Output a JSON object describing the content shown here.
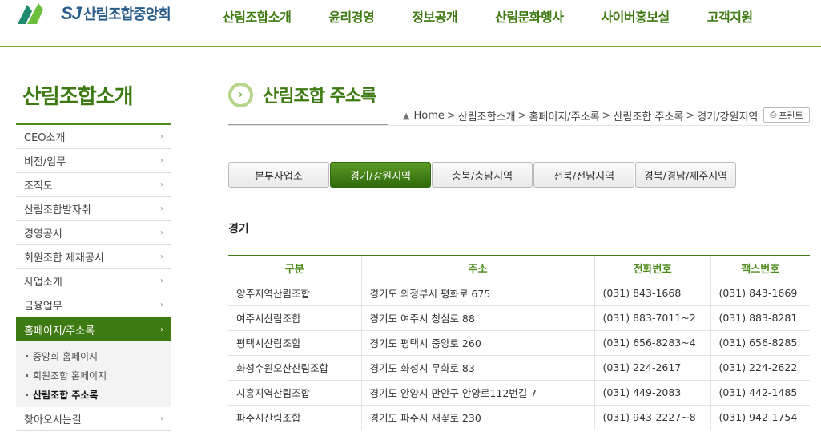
{
  "header": {
    "logo_sj": "SJ",
    "logo_text": "산림조합중앙회",
    "nav": [
      "산림조합소개",
      "윤리경영",
      "정보공개",
      "산림문화행사",
      "사이버홍보실",
      "고객지원"
    ]
  },
  "sidebar": {
    "title": "산림조합소개",
    "items": [
      {
        "label": "CEO소개"
      },
      {
        "label": "비전/임무"
      },
      {
        "label": "조직도"
      },
      {
        "label": "산림조합발자취"
      },
      {
        "label": "경영공시"
      },
      {
        "label": "회원조합 제재공시"
      },
      {
        "label": "사업소개"
      },
      {
        "label": "금융업무"
      },
      {
        "label": "홈페이지/주소록"
      }
    ],
    "sub_items": [
      {
        "label": "중앙회 홈페이지"
      },
      {
        "label": "회원조합 홈페이지"
      },
      {
        "label": "산림조합 주소록"
      }
    ],
    "last_item": {
      "label": "찾아오시는길"
    },
    "arrow": "›"
  },
  "main": {
    "title": "산림조합 주소록",
    "breadcrumb": [
      "Home",
      "산림조합소개",
      "홈페이지/주소록",
      "산림조합 주소록",
      "경기/강원지역"
    ],
    "breadcrumb_sep": ">",
    "print_label": "프린트",
    "tabs": [
      "본부사업소",
      "경기/강원지역",
      "충북/충남지역",
      "전북/전남지역",
      "경북/경남/제주지역"
    ],
    "section_title": "경기",
    "table": {
      "headers": [
        "구분",
        "주소",
        "전화번호",
        "팩스번호"
      ],
      "rows": [
        [
          "양주지역산림조합",
          "경기도 의정부시 평화로 675",
          "(031) 843-1668",
          "(031) 843-1669"
        ],
        [
          "여주시산림조합",
          "경기도 여주시 청심로 88",
          "(031) 883-7011~2",
          "(031) 883-8281"
        ],
        [
          "평택시산림조합",
          "경기도 평택시 중앙로 260",
          "(031) 656-8283~4",
          "(031) 656-8285"
        ],
        [
          "화성수원오산산림조합",
          "경기도 화성시 무화로 83",
          "(031) 224-2617",
          "(031) 224-2622"
        ],
        [
          "시흥지역산림조합",
          "경기도 안양시 만안구 안양로112번길 7",
          "(031) 449-2083",
          "(031) 442-1485"
        ],
        [
          "파주시산림조합",
          "경기도 파주시 새꽃로 230",
          "(031) 943-2227~8",
          "(031) 942-1754"
        ]
      ]
    }
  },
  "colors": {
    "brand_green": "#3e7a12",
    "accent_light": "#7aa93c"
  }
}
